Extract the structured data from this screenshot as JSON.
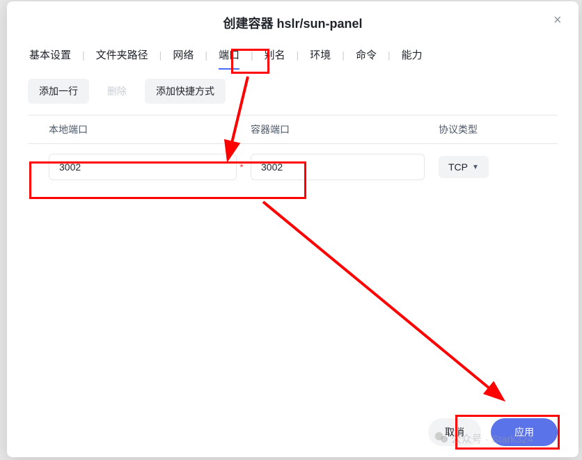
{
  "modal": {
    "title": "创建容器 hslr/sun-panel",
    "close_label": "×"
  },
  "tabs": {
    "items": [
      "基本设置",
      "文件夹路径",
      "网络",
      "端口",
      "别名",
      "环境",
      "命令",
      "能力"
    ],
    "active_index": 3
  },
  "toolbar": {
    "add_row": "添加一行",
    "delete": "删除",
    "add_shortcut": "添加快捷方式"
  },
  "table": {
    "headers": {
      "local_port": "本地端口",
      "container_port": "容器端口",
      "protocol": "协议类型"
    },
    "rows": [
      {
        "local_port": "3002",
        "container_port": "3002",
        "protocol": "TCP"
      }
    ]
  },
  "footer": {
    "cancel": "取消",
    "apply": "应用"
  },
  "watermark": {
    "text": "公众号 · Stark324"
  },
  "annotations": {
    "highlight_color": "#ff0000",
    "boxes": [
      {
        "target": "port-tab"
      },
      {
        "target": "port-inputs"
      },
      {
        "target": "apply-button"
      }
    ],
    "arrows": [
      {
        "from": "port-tab",
        "to": "port-inputs"
      },
      {
        "from": "port-inputs",
        "to": "apply-button"
      }
    ]
  }
}
